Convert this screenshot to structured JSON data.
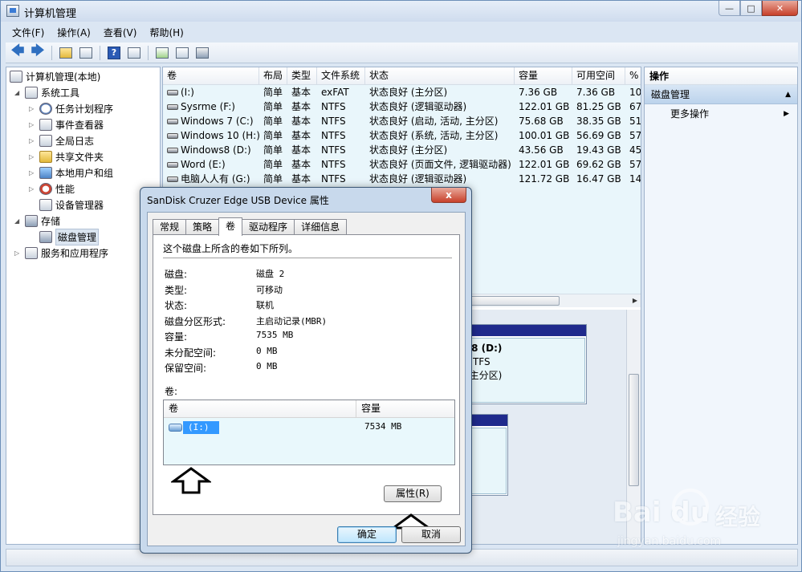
{
  "window": {
    "title": "计算机管理"
  },
  "menu": [
    "文件(F)",
    "操作(A)",
    "查看(V)",
    "帮助(H)"
  ],
  "tree": {
    "root": "计算机管理(本地)",
    "items": [
      {
        "label": "系统工具",
        "level": 1,
        "expanded": true
      },
      {
        "label": "任务计划程序",
        "level": 2
      },
      {
        "label": "事件查看器",
        "level": 2
      },
      {
        "label": "全局日志",
        "level": 2
      },
      {
        "label": "共享文件夹",
        "level": 2
      },
      {
        "label": "本地用户和组",
        "level": 2
      },
      {
        "label": "性能",
        "level": 2
      },
      {
        "label": "设备管理器",
        "level": 2
      },
      {
        "label": "存储",
        "level": 1,
        "expanded": true
      },
      {
        "label": "磁盘管理",
        "level": 2,
        "selected": true
      },
      {
        "label": "服务和应用程序",
        "level": 1
      }
    ]
  },
  "volumes": {
    "headers": [
      "卷",
      "布局",
      "类型",
      "文件系统",
      "状态",
      "容量",
      "可用空间",
      "%"
    ],
    "rows": [
      [
        "(I:)",
        "简单",
        "基本",
        "exFAT",
        "状态良好 (主分区)",
        "7.36 GB",
        "7.36 GB",
        "10"
      ],
      [
        "Sysrme (F:)",
        "简单",
        "基本",
        "NTFS",
        "状态良好 (逻辑驱动器)",
        "122.01 GB",
        "81.25 GB",
        "67"
      ],
      [
        "Windows 7  (C:)",
        "简单",
        "基本",
        "NTFS",
        "状态良好 (启动, 活动, 主分区)",
        "75.68 GB",
        "38.35 GB",
        "51"
      ],
      [
        "Windows 10 (H:)",
        "简单",
        "基本",
        "NTFS",
        "状态良好 (系统, 活动, 主分区)",
        "100.01 GB",
        "56.69 GB",
        "57"
      ],
      [
        "Windows8 (D:)",
        "简单",
        "基本",
        "NTFS",
        "状态良好 (主分区)",
        "43.56 GB",
        "19.43 GB",
        "45"
      ],
      [
        "Word (E:)",
        "简单",
        "基本",
        "NTFS",
        "状态良好 (页面文件, 逻辑驱动器)",
        "122.01 GB",
        "69.62 GB",
        "57"
      ],
      [
        "电脑人人有 (G:)",
        "简单",
        "基本",
        "NTFS",
        "状态良好 (逻辑驱动器)",
        "121.72 GB",
        "16.47 GB",
        "14"
      ]
    ]
  },
  "disk_panel": {
    "line1": "s8  (D:)",
    "line2": "NTFS",
    "line3": "(主分区)"
  },
  "actions": {
    "header": "操作",
    "section": "磁盘管理",
    "more": "更多操作"
  },
  "dialog": {
    "title": "SanDisk Cruzer Edge USB Device 属性",
    "close": "x",
    "tabs": [
      "常规",
      "策略",
      "卷",
      "驱动程序",
      "详细信息"
    ],
    "intro": "这个磁盘上所含的卷如下所列。",
    "props": [
      {
        "label": "磁盘:",
        "value": "磁盘 2"
      },
      {
        "label": "类型:",
        "value": "可移动"
      },
      {
        "label": "状态:",
        "value": "联机"
      },
      {
        "label": "磁盘分区形式:",
        "value": "主启动记录(MBR)"
      },
      {
        "label": "容量:",
        "value": "7535 MB"
      },
      {
        "label": "未分配空间:",
        "value": "0 MB"
      },
      {
        "label": "保留空间:",
        "value": "0 MB"
      }
    ],
    "volumes_label": "卷:",
    "list_headers": [
      "卷",
      "容量"
    ],
    "list_rows": [
      {
        "name": "(I:)",
        "capacity": "7534 MB"
      }
    ],
    "properties_button": "属性(R)",
    "ok_button": "确定",
    "cancel_button": "取消"
  },
  "watermark": {
    "brand": "Bai  du",
    "cn": "经验",
    "url": "jingyan.baidu.com"
  }
}
